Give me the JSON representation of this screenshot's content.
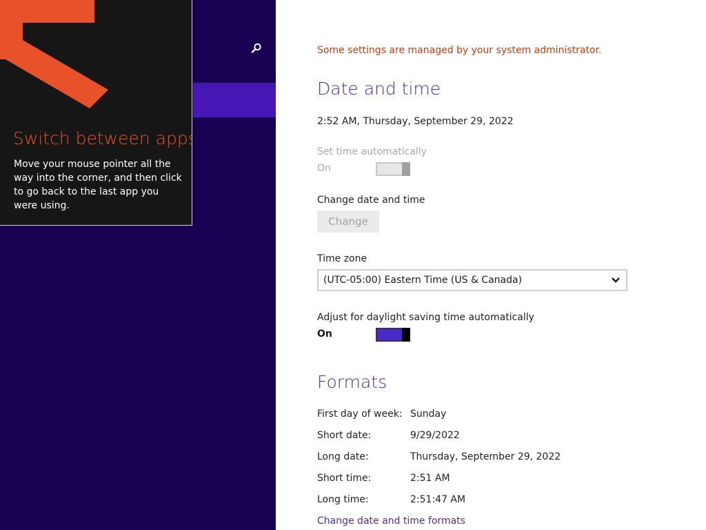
{
  "tip": {
    "title": "Switch between apps",
    "body": "Move your mouse pointer all the way into the corner, and then click to go back to the last app you were using.",
    "accent_color": "#e8522a"
  },
  "nav": {
    "search_icon": "search-icon",
    "selection_color": "#4617b4",
    "background_color": "#180052"
  },
  "settings": {
    "admin_note": "Some settings are managed by your system administrator.",
    "date_time": {
      "title": "Date and time",
      "current": "2:52 AM, Thursday, September 29, 2022",
      "set_auto": {
        "label": "Set time automatically",
        "state": "On",
        "enabled": false
      },
      "change": {
        "label": "Change date and time",
        "button": "Change"
      },
      "timezone": {
        "label": "Time zone",
        "selected": "(UTC-05:00) Eastern Time (US & Canada)"
      },
      "dst": {
        "label": "Adjust for daylight saving time automatically",
        "state": "On",
        "enabled": true
      }
    },
    "formats": {
      "title": "Formats",
      "rows": [
        {
          "label": "First day of week:",
          "value": "Sunday"
        },
        {
          "label": "Short date:",
          "value": "9/29/2022"
        },
        {
          "label": "Long date:",
          "value": "Thursday, September 29, 2022"
        },
        {
          "label": "Short time:",
          "value": "2:51 AM"
        },
        {
          "label": "Long time:",
          "value": "2:51:47 AM"
        }
      ],
      "link": "Change date and time formats"
    }
  }
}
